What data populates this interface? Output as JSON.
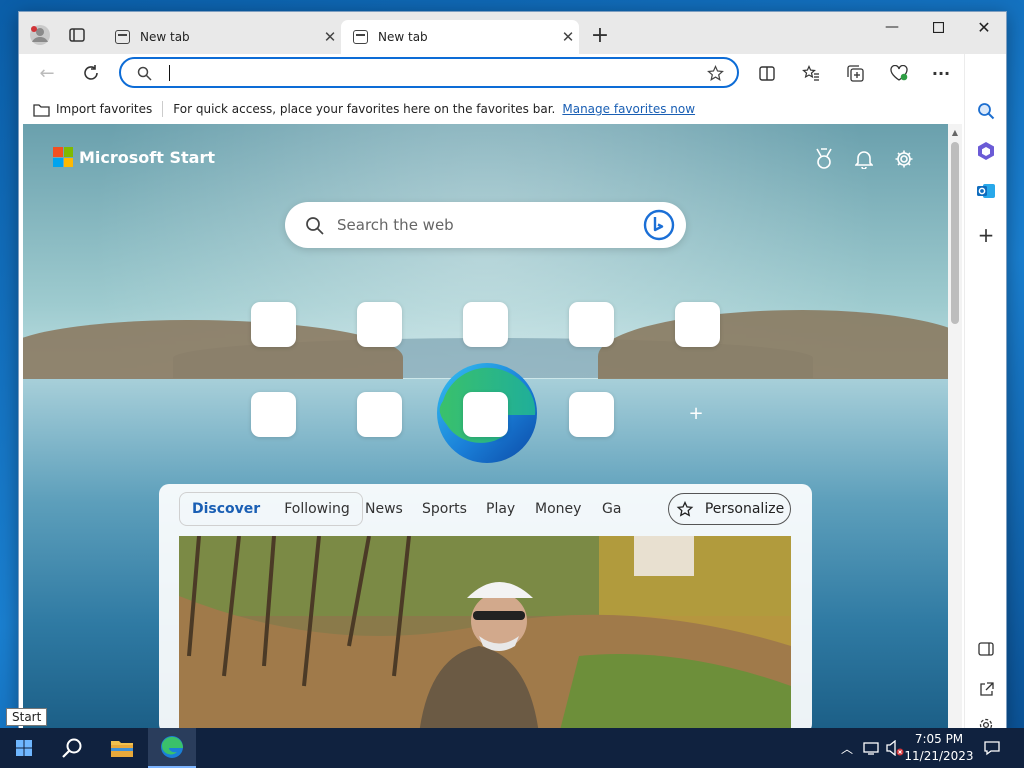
{
  "browser": {
    "tabs": [
      {
        "title": "New tab",
        "active": false
      },
      {
        "title": "New tab",
        "active": true
      }
    ],
    "address": {
      "value": "",
      "placeholder": ""
    },
    "favorites_bar": {
      "import_label": "Import favorites",
      "message": "For quick access, place your favorites here on the favorites bar.",
      "manage_link": "Manage favorites now"
    }
  },
  "start_page": {
    "brand": "Microsoft Start",
    "search_placeholder": "Search the web",
    "feed": {
      "toggle": [
        "Discover",
        "Following"
      ],
      "categories": [
        "News",
        "Sports",
        "Play",
        "Money",
        "Ga"
      ],
      "personalize_label": "Personalize"
    }
  },
  "taskbar": {
    "start_tooltip": "Start",
    "time": "7:05 PM",
    "date": "11/21/2023"
  },
  "colors": {
    "accent": "#0d6cd6",
    "taskbar_bg": "#10223f",
    "link": "#1a5fb4"
  },
  "icons": [
    "profile-icon",
    "tab-actions-icon",
    "new-tab-icon",
    "minimize-icon",
    "maximize-icon",
    "close-icon",
    "back-icon",
    "refresh-icon",
    "search-icon",
    "favorite-star-icon",
    "split-screen-icon",
    "favorites-icon",
    "collections-icon",
    "browser-essentials-icon",
    "more-icon",
    "copilot-icon",
    "sidebar-search-icon",
    "sidebar-m365-icon",
    "sidebar-outlook-icon",
    "sidebar-add-icon",
    "rewards-icon",
    "notifications-icon",
    "settings-icon",
    "bing-chat-icon",
    "windows-start-icon",
    "taskbar-search-icon",
    "file-explorer-icon",
    "edge-taskbar-icon",
    "show-hidden-icons-icon",
    "network-icon",
    "volume-muted-icon",
    "action-center-icon"
  ]
}
